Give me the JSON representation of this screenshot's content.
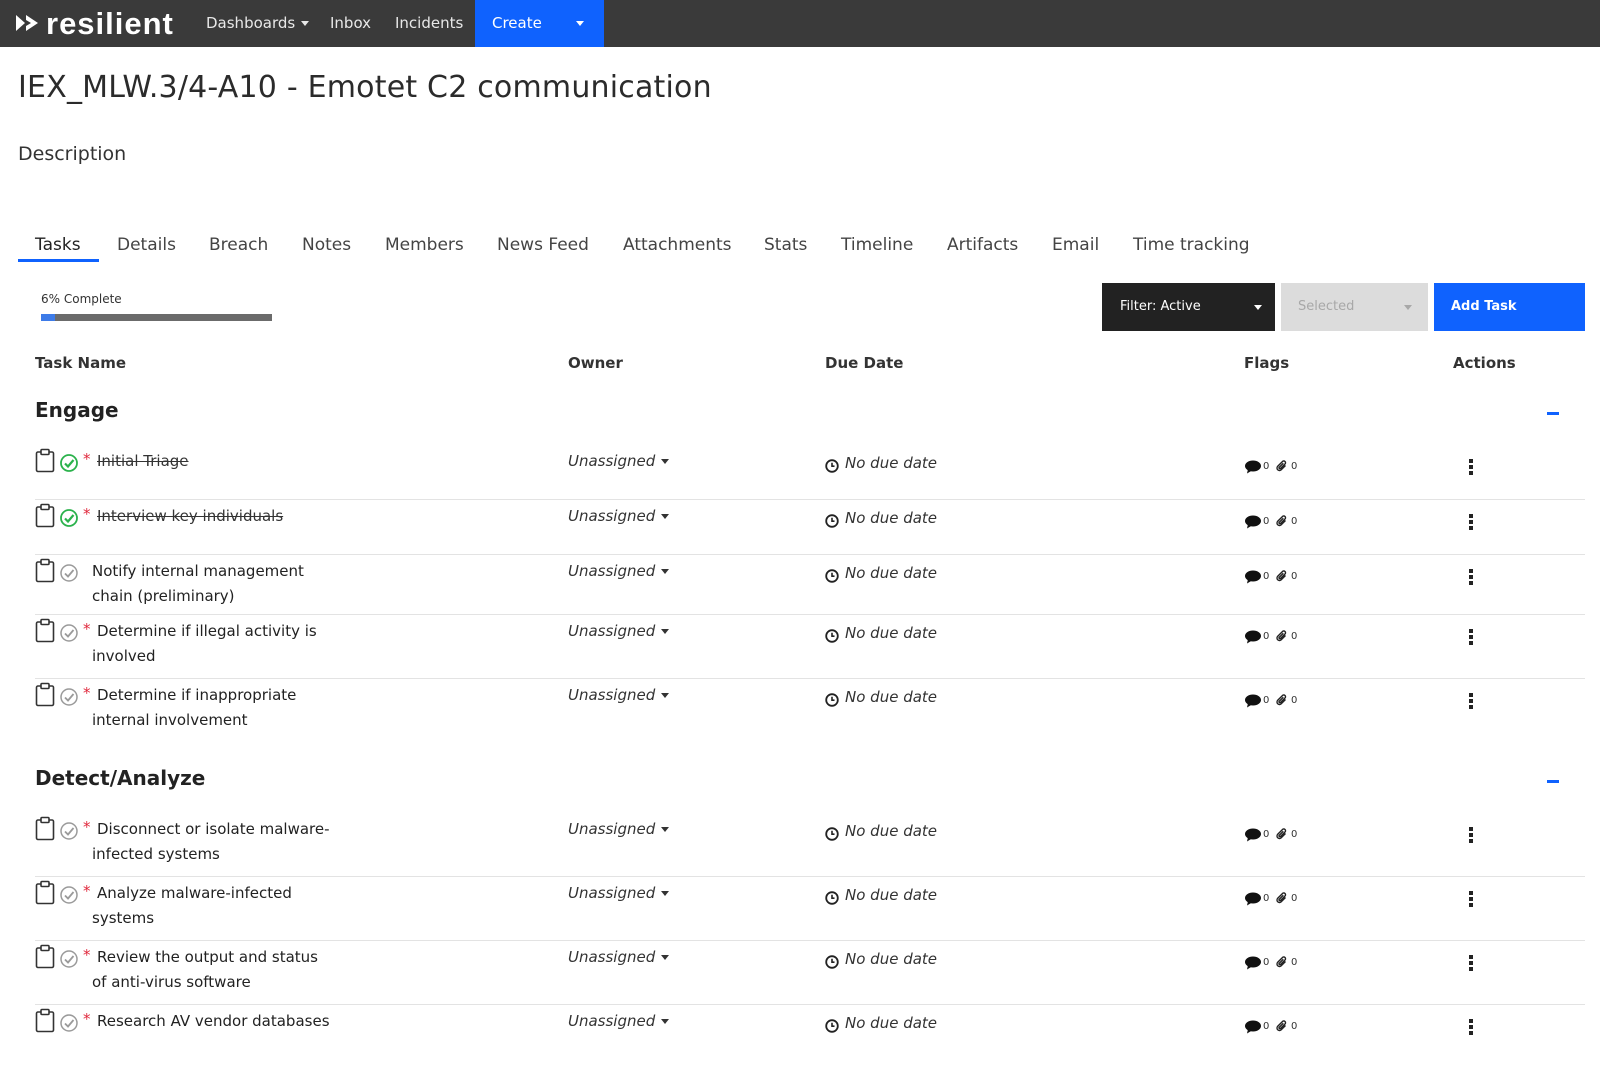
{
  "app": {
    "logo_text": "resilient"
  },
  "nav": {
    "dashboards": "Dashboards",
    "inbox": "Inbox",
    "incidents": "Incidents",
    "create": "Create"
  },
  "page": {
    "title": "IEX_MLW.3/4-A10 - Emotet C2 communication",
    "description_label": "Description"
  },
  "tabs": [
    "Tasks",
    "Details",
    "Breach",
    "Notes",
    "Members",
    "News Feed",
    "Attachments",
    "Stats",
    "Timeline",
    "Artifacts",
    "Email",
    "Time tracking"
  ],
  "active_tab": "Tasks",
  "progress": {
    "label": "6% Complete",
    "percent": 6
  },
  "controls": {
    "filter": "Filter: Active",
    "selected": "Selected",
    "add_task": "Add Task"
  },
  "columns": {
    "task_name": "Task Name",
    "owner": "Owner",
    "due_date": "Due Date",
    "flags": "Flags",
    "actions": "Actions"
  },
  "groups": [
    {
      "title": "Engage",
      "tasks": [
        {
          "name": "Initial Triage",
          "done": true,
          "required": true,
          "owner": "Unassigned",
          "due": "No due date",
          "comments": "0",
          "attachments": "0"
        },
        {
          "name": "Interview key individuals",
          "done": true,
          "required": true,
          "owner": "Unassigned",
          "due": "No due date",
          "comments": "0",
          "attachments": "0"
        },
        {
          "name": "Notify internal management chain (preliminary)",
          "done": false,
          "required": false,
          "owner": "Unassigned",
          "due": "No due date",
          "comments": "0",
          "attachments": "0"
        },
        {
          "name": "Determine if illegal activity is involved",
          "done": false,
          "required": true,
          "owner": "Unassigned",
          "due": "No due date",
          "comments": "0",
          "attachments": "0"
        },
        {
          "name": "Determine if inappropriate internal involvement",
          "done": false,
          "required": true,
          "owner": "Unassigned",
          "due": "No due date",
          "comments": "0",
          "attachments": "0"
        }
      ]
    },
    {
      "title": "Detect/Analyze",
      "tasks": [
        {
          "name": "Disconnect or isolate malware-infected systems",
          "done": false,
          "required": true,
          "owner": "Unassigned",
          "due": "No due date",
          "comments": "0",
          "attachments": "0"
        },
        {
          "name": "Analyze malware-infected systems",
          "done": false,
          "required": true,
          "owner": "Unassigned",
          "due": "No due date",
          "comments": "0",
          "attachments": "0"
        },
        {
          "name": "Review the output and status of anti-virus software",
          "done": false,
          "required": true,
          "owner": "Unassigned",
          "due": "No due date",
          "comments": "0",
          "attachments": "0"
        },
        {
          "name": "Research AV vendor databases",
          "done": false,
          "required": true,
          "owner": "Unassigned",
          "due": "No due date",
          "comments": "0",
          "attachments": "0"
        }
      ]
    }
  ],
  "colors": {
    "topbar": "#3a3a3a",
    "accent": "#0f62fe",
    "required": "#e0283c",
    "done_check": "#2bb24c"
  }
}
